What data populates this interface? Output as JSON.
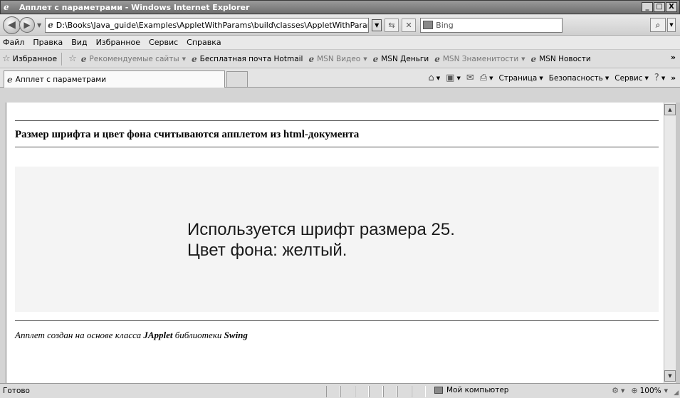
{
  "window": {
    "title": "Апплет с параметрами - Windows Internet Explorer",
    "minimize": "_",
    "maximize": "□",
    "close": "X"
  },
  "address": {
    "url": "D:\\Books\\Java_guide\\Examples\\AppletWithParams\\build\\classes\\AppletWithParams.html",
    "search_placeholder": "Bing"
  },
  "menu": [
    "Файл",
    "Правка",
    "Вид",
    "Избранное",
    "Сервис",
    "Справка"
  ],
  "favorites": {
    "label": "Избранное",
    "items": [
      {
        "label": "Рекомендуемые сайты",
        "dim": true,
        "dropdown": true
      },
      {
        "label": "Бесплатная почта Hotmail",
        "dim": false,
        "dropdown": false
      },
      {
        "label": "MSN Видео",
        "dim": true,
        "dropdown": true
      },
      {
        "label": "MSN Деньги",
        "dim": false,
        "dropdown": false
      },
      {
        "label": "MSN Знаменитости",
        "dim": true,
        "dropdown": true
      },
      {
        "label": "MSN Новости",
        "dim": false,
        "dropdown": false
      }
    ]
  },
  "tab": {
    "label": "Апплет с параметрами"
  },
  "commands": {
    "page": "Страница",
    "safety": "Безопасность",
    "tools": "Сервис"
  },
  "page": {
    "heading": "Размер шрифта и цвет фона считываются апплетом из html-документа",
    "applet_line1": "Используется шрифт размера 25.",
    "applet_line2": "Цвет фона: желтый.",
    "footer_part1": "Апплет создан на основе класса ",
    "footer_bold1": "JApplet",
    "footer_part2": " библиотеки ",
    "footer_bold2": "Swing"
  },
  "status": {
    "text": "Готово",
    "zone": "Мой компьютер",
    "zoom": "100%"
  }
}
